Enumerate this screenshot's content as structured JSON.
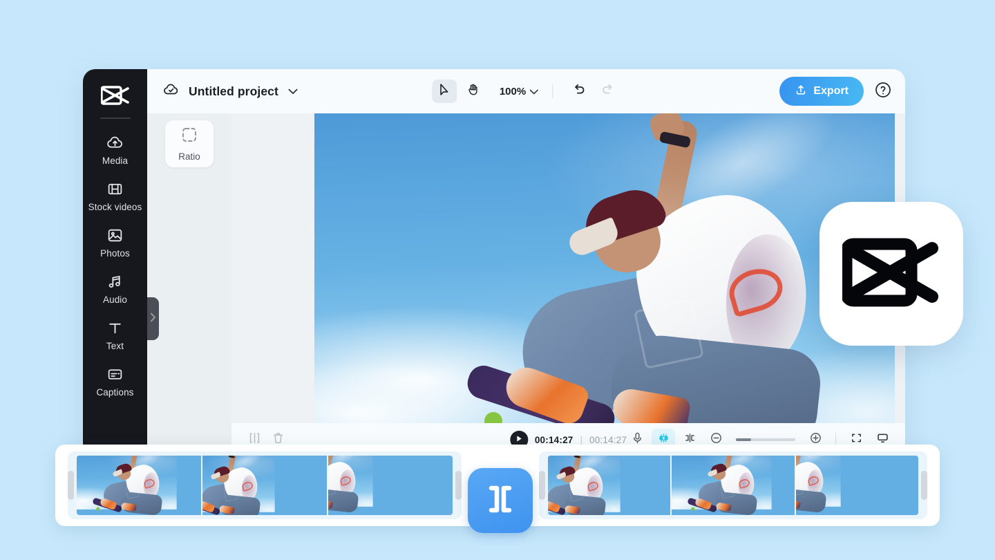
{
  "app": {
    "name": "CapCut",
    "project_title": "Untitled project",
    "zoom_level": "100%"
  },
  "sidebar": {
    "logo_icon": "capcut-logo-icon",
    "items": [
      {
        "label": "Media",
        "icon": "cloud-upload-icon"
      },
      {
        "label": "Stock videos",
        "icon": "film-strip-icon"
      },
      {
        "label": "Photos",
        "icon": "image-icon"
      },
      {
        "label": "Audio",
        "icon": "music-note-icon"
      },
      {
        "label": "Text",
        "icon": "text-t-icon"
      },
      {
        "label": "Captions",
        "icon": "captions-icon"
      }
    ],
    "collapse_icon": "chevron-right-icon"
  },
  "topbar": {
    "cloud_icon": "cloud-check-icon",
    "title_caret_icon": "chevron-down-icon",
    "select_tool_icon": "cursor-arrow-icon",
    "hand_tool_icon": "hand-icon",
    "zoom_label": "100%",
    "zoom_caret_icon": "chevron-down-icon",
    "undo_icon": "undo-arrow-icon",
    "redo_icon": "redo-arrow-icon",
    "export_label": "Export",
    "export_icon": "upload-icon",
    "help_icon": "question-circle-icon",
    "accent_color": "#3f97f0"
  },
  "panel": {
    "ratio_label": "Ratio",
    "ratio_icon": "dashed-square-icon"
  },
  "player": {
    "split_icon": "split-clip-icon",
    "delete_icon": "trash-icon",
    "play_icon": "play-triangle-icon",
    "current_time": "00:14:27",
    "separator": "|",
    "total_time": "00:14:27",
    "mic_icon": "microphone-icon",
    "ai_icon": "ai-robot-icon",
    "ai_highlight_color": "#24c8e8",
    "split_marker_icon": "split-marker-icon",
    "zoom_out_icon": "minus-circle-icon",
    "zoom_in_icon": "plus-circle-icon",
    "fullscreen_icon": "fullscreen-icon",
    "display_icon": "monitor-icon"
  },
  "timeline": {
    "left_clip_frames": 3,
    "right_clip_frames": 3,
    "left_handle_icon": "drag-handle-icon",
    "right_handle_icon": "drag-handle-icon",
    "transition_icon": "transition-brackets-icon"
  },
  "brand": {
    "logo_icon": "capcut-logo-icon"
  },
  "colors": {
    "page_background": "#c7e8fc",
    "rail_background": "#16181d",
    "panel_background": "#eaeff1",
    "preview_background": "#eef2f4",
    "topbar_background": "#f8fbfd"
  }
}
